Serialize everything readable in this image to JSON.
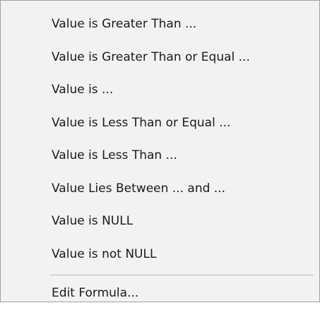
{
  "menu": {
    "items": [
      {
        "label": "Value is Greater Than ..."
      },
      {
        "label": "Value is Greater Than or Equal ..."
      },
      {
        "label": "Value is ..."
      },
      {
        "label": "Value is Less Than or Equal ..."
      },
      {
        "label": "Value is Less Than ..."
      },
      {
        "label": "Value Lies Between ... and ..."
      },
      {
        "label": "Value is NULL"
      },
      {
        "label": "Value is not NULL"
      }
    ],
    "edit_formula_label": "Edit Formula..."
  }
}
